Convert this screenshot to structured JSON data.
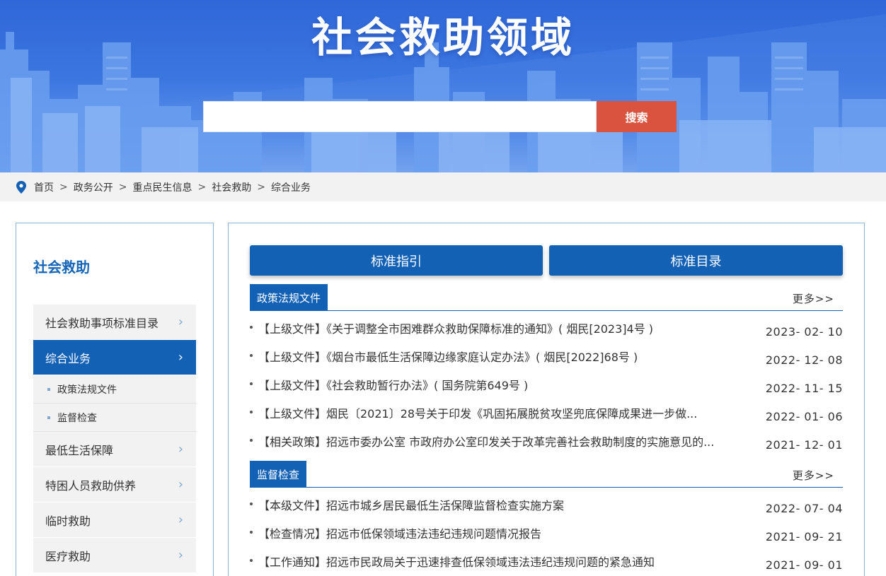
{
  "banner": {
    "title": "社会救助领域",
    "search_placeholder": "",
    "search_button": "搜索"
  },
  "breadcrumb": {
    "items": [
      "首页",
      "政务公开",
      "重点民生信息",
      "社会救助",
      "综合业务"
    ],
    "separator": ">"
  },
  "sidebar": {
    "title": "社会救助",
    "items": [
      {
        "label": "社会救助事项标准目录"
      },
      {
        "label": "综合业务"
      },
      {
        "label": "最低生活保障"
      },
      {
        "label": "特困人员救助供养"
      },
      {
        "label": "临时救助"
      },
      {
        "label": "医疗救助"
      }
    ],
    "sub_items": [
      {
        "label": "政策法规文件"
      },
      {
        "label": "监督检查"
      }
    ],
    "chevron": "›"
  },
  "main": {
    "buttons": [
      "标准指引",
      "标准目录"
    ],
    "sections": [
      {
        "label": "政策法规文件",
        "more": "更多>>",
        "items": [
          {
            "title": "【上级文件】《关于调整全市困难群众救助保障标准的通知》( 烟民[2023]4号 )",
            "date": "2023- 02- 10"
          },
          {
            "title": "【上级文件】《烟台市最低生活保障边缘家庭认定办法》( 烟民[2022]68号 )",
            "date": "2022- 12- 08"
          },
          {
            "title": "【上级文件】《社会救助暂行办法》( 国务院第649号 )",
            "date": "2022- 11- 15"
          },
          {
            "title": "【上级文件】烟民〔2021〕28号关于印发《巩固拓展脱贫攻坚兜底保障成果进一步做...",
            "date": "2022- 01- 06"
          },
          {
            "title": "【相关政策】招远市委办公室 市政府办公室印发关于改革完善社会救助制度的实施意见的...",
            "date": "2021- 12- 01"
          }
        ]
      },
      {
        "label": "监督检查",
        "more": "更多>>",
        "items": [
          {
            "title": "【本级文件】招远市城乡居民最低生活保障监督检查实施方案",
            "date": "2022- 07- 04"
          },
          {
            "title": "【检查情况】招远市低保领域违法违纪违规问题情况报告",
            "date": "2021- 09- 21"
          },
          {
            "title": "【工作通知】招远市民政局关于迅速排查低保领域违法违纪违规问题的紧急通知",
            "date": "2021- 09- 01"
          }
        ]
      }
    ]
  },
  "colors": {
    "primary": "#1361b5",
    "search_button": "#d9533f",
    "banner": "#2f67d8"
  }
}
